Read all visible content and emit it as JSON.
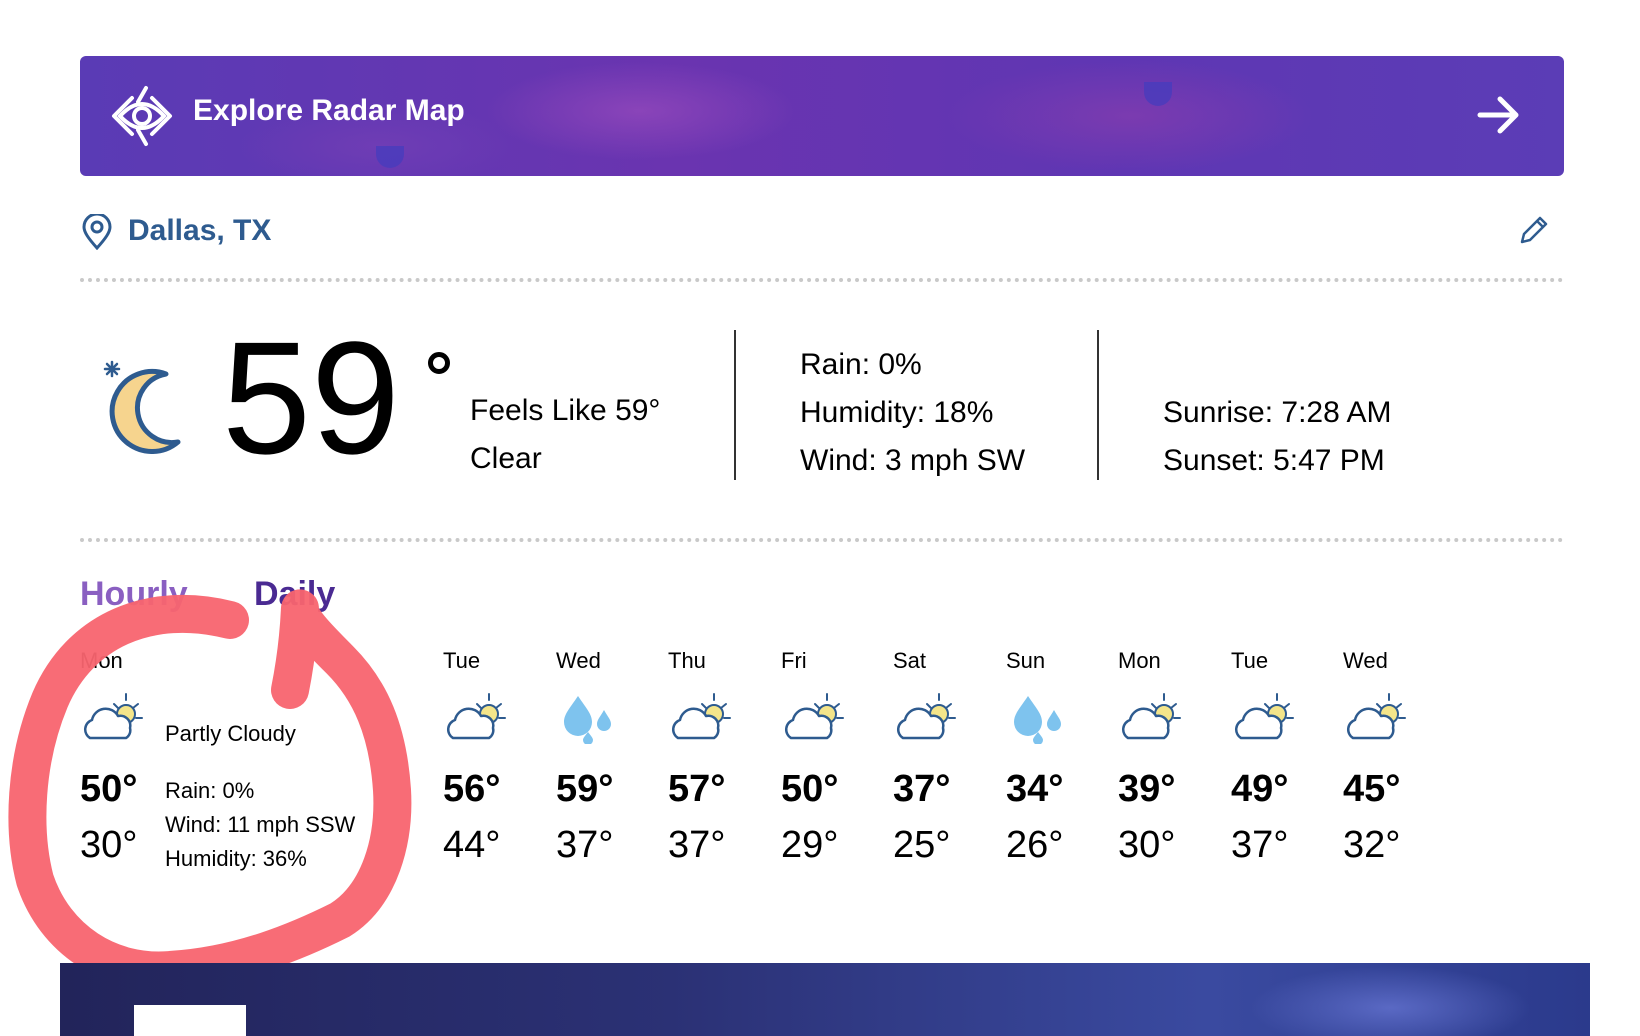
{
  "radar": {
    "title": "Explore Radar Map",
    "icon": "radar-eye-icon",
    "arrow_icon": "arrow-right-icon"
  },
  "location": {
    "name": "Dallas, TX",
    "pin_icon": "location-pin-icon",
    "edit_icon": "pencil-icon"
  },
  "current": {
    "icon": "moon-icon",
    "temperature": "59",
    "feels_like": "Feels Like 59°",
    "condition": "Clear",
    "rain": "Rain: 0%",
    "humidity": "Humidity: 18%",
    "wind": "Wind: 3 mph SW",
    "sunrise": "Sunrise: 7:28 AM",
    "sunset": "Sunset: 5:47 PM"
  },
  "tabs": {
    "hourly": "Hourly",
    "daily": "Daily"
  },
  "today": {
    "day": "Mon",
    "icon": "partly-cloudy-icon",
    "condition": "Partly Cloudy",
    "high": "50°",
    "low": "30°",
    "rain": "Rain: 0%",
    "wind": "Wind: 11 mph SSW",
    "humidity": "Humidity: 36%"
  },
  "forecast": [
    {
      "day": "Tue",
      "icon": "partly-cloudy-icon",
      "high": "56°",
      "low": "44°"
    },
    {
      "day": "Wed",
      "icon": "rain-drops-icon",
      "high": "59°",
      "low": "37°"
    },
    {
      "day": "Thu",
      "icon": "partly-cloudy-icon",
      "high": "57°",
      "low": "37°"
    },
    {
      "day": "Fri",
      "icon": "partly-cloudy-icon",
      "high": "50°",
      "low": "29°"
    },
    {
      "day": "Sat",
      "icon": "partly-cloudy-icon",
      "high": "37°",
      "low": "25°"
    },
    {
      "day": "Sun",
      "icon": "rain-drops-icon",
      "high": "34°",
      "low": "26°"
    },
    {
      "day": "Mon",
      "icon": "partly-cloudy-icon",
      "high": "39°",
      "low": "30°"
    },
    {
      "day": "Tue",
      "icon": "partly-cloudy-icon",
      "high": "49°",
      "low": "37°"
    },
    {
      "day": "Wed",
      "icon": "partly-cloudy-icon",
      "high": "45°",
      "low": "32°"
    }
  ],
  "colors": {
    "radar_purple": "#5f36b3",
    "location_blue": "#2e5b8f",
    "tab_daily": "#4a2a92",
    "tab_hourly": "#8a5fc1",
    "annotation_red": "#f8646f"
  }
}
